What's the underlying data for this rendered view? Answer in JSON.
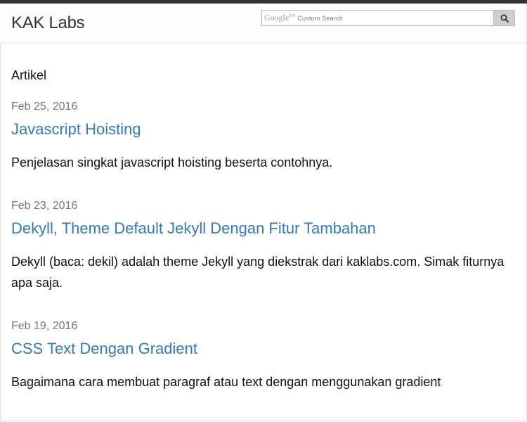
{
  "header": {
    "brand": "KAK Labs",
    "search": {
      "watermark_brand": "Google",
      "watermark_tm": "TM",
      "watermark_text": "Custom Search",
      "button_icon": "search-icon"
    }
  },
  "main": {
    "section_title": "Artikel",
    "posts": [
      {
        "date": "Feb 25, 2016",
        "title": "Javascript Hoisting",
        "excerpt": "Penjelasan singkat javascript hoisting beserta contohnya."
      },
      {
        "date": "Feb 23, 2016",
        "title": "Dekyll, Theme Default Jekyll Dengan Fitur Tambahan",
        "excerpt": "Dekyll (baca: dekil) adalah theme Jekyll yang diekstrak dari kaklabs.com. Simak fiturnya apa saja."
      },
      {
        "date": "Feb 19, 2016",
        "title": "CSS Text Dengan Gradient",
        "excerpt": "Bagaimana cara membuat paragraf atau text dengan menggunakan gradient"
      }
    ]
  },
  "colors": {
    "link": "#337ab7",
    "date": "#777777",
    "topbar": "#333333"
  }
}
